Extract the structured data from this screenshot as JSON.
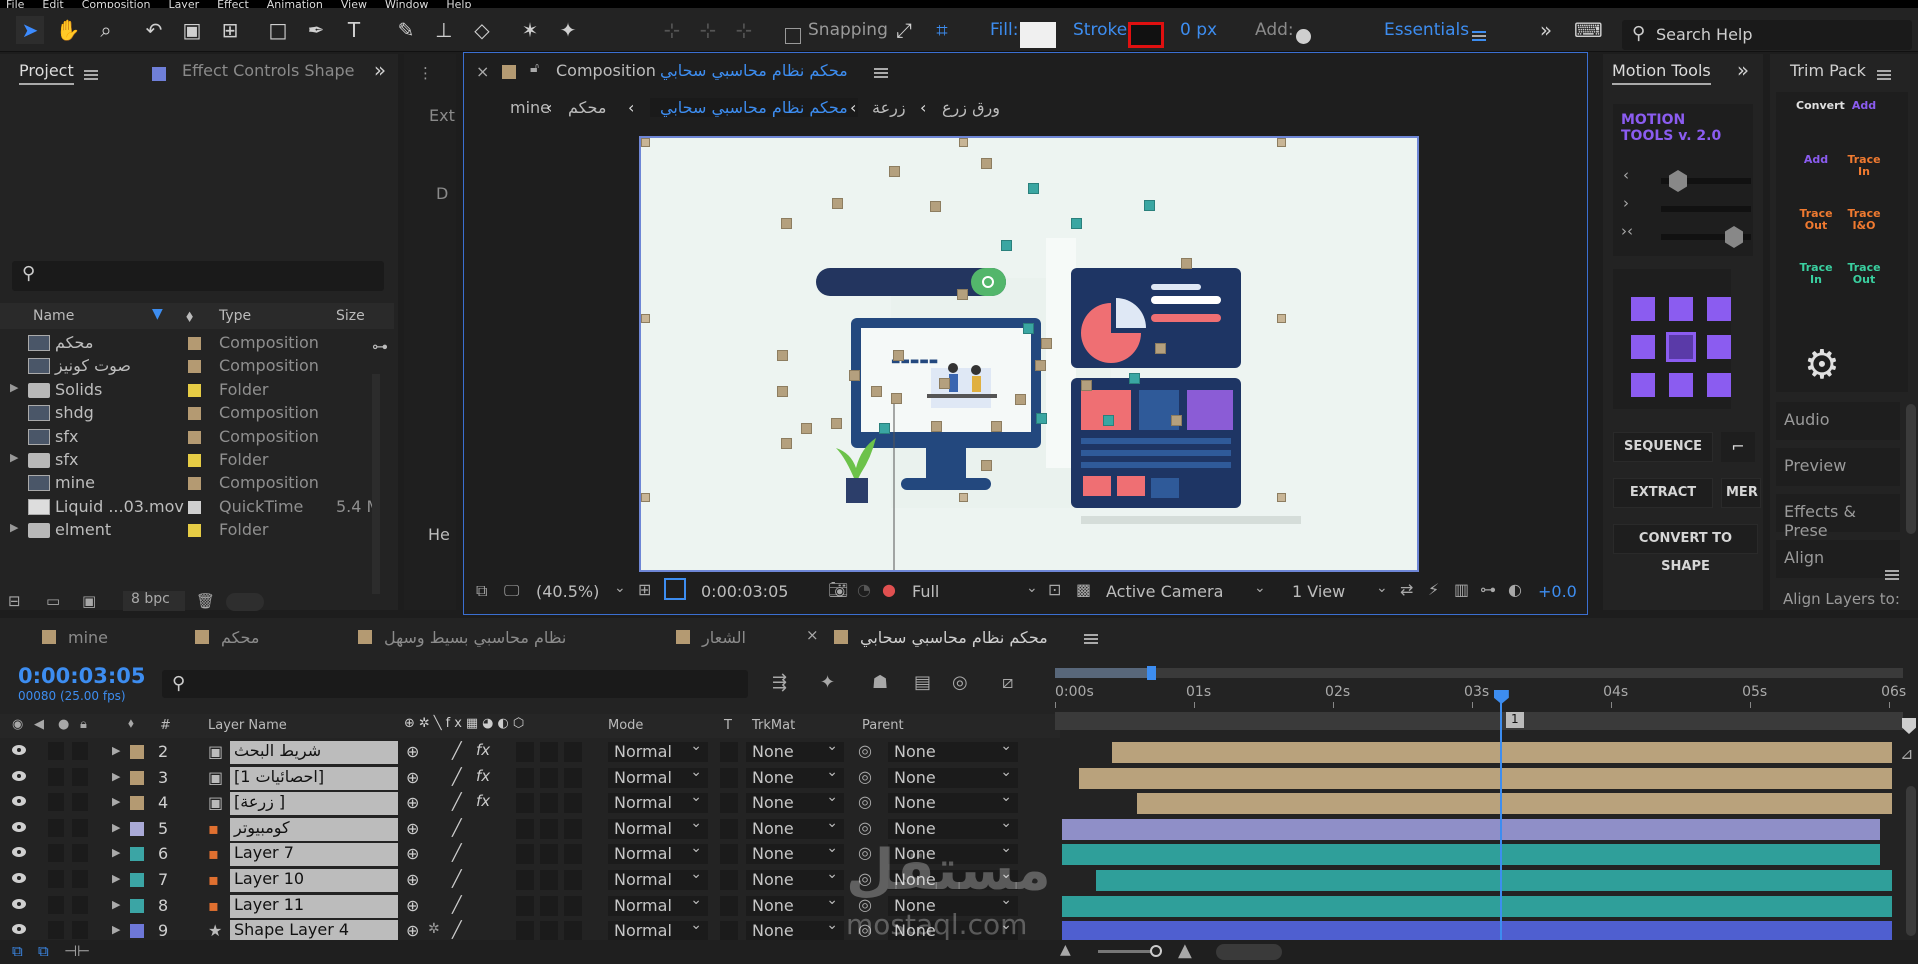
{
  "menubar": [
    "File",
    "Edit",
    "Composition",
    "Layer",
    "Effect",
    "Animation",
    "View",
    "Window",
    "Help"
  ],
  "toolbar": {
    "snapping_label": "Snapping",
    "fill_label": "Fill:",
    "stroke_label": "Stroke:",
    "stroke_px": "0 px",
    "add_label": "Add:",
    "workspace": "Essentials",
    "search_placeholder": "Search Help",
    "colors": {
      "accent": "#3d8df0",
      "stroke_color": "#e01010",
      "fill_color": "#f0f0f0"
    }
  },
  "project_panel": {
    "tab_project": "Project",
    "tab_effect_controls": "Effect Controls Shape",
    "columns": {
      "name": "Name",
      "type": "Type",
      "size": "Size"
    },
    "items": [
      {
        "name": "محكم",
        "type": "Composition",
        "size": "",
        "kind": "comp",
        "color": "#b49a72"
      },
      {
        "name": "صوت كونيز",
        "type": "Composition",
        "size": "",
        "kind": "comp",
        "color": "#b49a72"
      },
      {
        "name": "Solids",
        "type": "Folder",
        "size": "",
        "kind": "folder",
        "color": "#e6cc45"
      },
      {
        "name": "shdg",
        "type": "Composition",
        "size": "",
        "kind": "comp",
        "color": "#b49a72"
      },
      {
        "name": "sfx",
        "type": "Composition",
        "size": "",
        "kind": "comp",
        "color": "#b49a72"
      },
      {
        "name": "sfx",
        "type": "Folder",
        "size": "",
        "kind": "folder",
        "color": "#e6cc45"
      },
      {
        "name": "mine",
        "type": "Composition",
        "size": "",
        "kind": "comp",
        "color": "#b49a72"
      },
      {
        "name": "Liquid ...03.mov",
        "type": "QuickTime",
        "size": "5.4 M",
        "kind": "movie",
        "color": "#cfcfcf"
      },
      {
        "name": "elment",
        "type": "Folder",
        "size": "",
        "kind": "folder",
        "color": "#e6cc45"
      }
    ],
    "bpc": "8 bpc"
  },
  "side_strip": {
    "a": "Ext",
    "b": "D",
    "c": "He"
  },
  "comp_viewer": {
    "tab_label": "Composition",
    "tab_comp_name": "محكم نظام محاسبي سحابي",
    "breadcrumbs": [
      "mine",
      "محكم",
      "محكم نظام محاسبي سحابي",
      "زرعة",
      "ورق زرع"
    ],
    "active_crumb": 2,
    "zoom": "(40.5%)",
    "timecode": "0:00:03:05",
    "resolution": "Full",
    "camera": "Active Camera",
    "views": "1 View",
    "exposure": "+0.0"
  },
  "motion_tools": {
    "tab_label": "Motion Tools",
    "logo_line1": "MOTION",
    "logo_line2": "TOOLS v. 2.0",
    "btn_sequence": "SEQUENCE",
    "btn_extract": "EXTRACT",
    "btn_merge": "MER",
    "btn_convert": "CONVERT TO SHAPE"
  },
  "trim_pack": {
    "tab_label": "Trim Pack",
    "buttons": [
      "Convert",
      "Add",
      "Add",
      "Trace In",
      "Trace Out",
      "Trace I&O",
      "Trace In",
      "Trace Out"
    ],
    "panels": [
      "Audio",
      "Preview",
      "Effects & Prese",
      "Align"
    ],
    "align_sub": "Align Layers to:"
  },
  "timeline": {
    "tabs": [
      {
        "label": "mine",
        "color": "#b49a72"
      },
      {
        "label": "محكم",
        "color": "#b49a72"
      },
      {
        "label": "نظام محاسبي بسيط وسهل",
        "color": "#b49a72"
      },
      {
        "label": "الشعار",
        "color": "#b49a72"
      },
      {
        "label": "محكم نظام محاسبي سحابي",
        "color": "#b49a72"
      }
    ],
    "timecode": "0:00:03:05",
    "frames": "00080 (25.00 fps)",
    "columns": {
      "hash": "#",
      "layer_name": "Layer Name",
      "mode": "Mode",
      "t": "T",
      "trkmat": "TrkMat",
      "parent": "Parent"
    },
    "ruler": [
      "0:00s",
      "01s",
      "02s",
      "03s",
      "04s",
      "05s",
      "06s"
    ],
    "marker": "1",
    "layers": [
      {
        "num": "2",
        "name": "شريط البحث",
        "mode": "Normal",
        "trkmat": "None",
        "parent": "None",
        "color": "#b49a72",
        "icon": "comp",
        "fx": true,
        "bar_start": 0.06,
        "bar_color": "#b9a27c"
      },
      {
        "num": "3",
        "name": "[احصائيات 1]",
        "mode": "Normal",
        "trkmat": "None",
        "parent": "None",
        "color": "#b49a72",
        "icon": "comp",
        "fx": true,
        "bar_start": 0.02,
        "bar_color": "#b9a27c"
      },
      {
        "num": "4",
        "name": "[زرعة ]",
        "mode": "Normal",
        "trkmat": "None",
        "parent": "None",
        "color": "#b49a72",
        "icon": "comp",
        "fx": true,
        "bar_start": 0.09,
        "bar_color": "#b9a27c"
      },
      {
        "num": "5",
        "name": "كومبيوتر",
        "mode": "Normal",
        "trkmat": "None",
        "parent": "None",
        "color": "#a9a9d6",
        "icon": "ai",
        "fx": false,
        "bar_start": 0.0,
        "bar_color": "#8f8fc8"
      },
      {
        "num": "6",
        "name": "Layer 7",
        "mode": "Normal",
        "trkmat": "None",
        "parent": "None",
        "color": "#3ba5a5",
        "icon": "ai",
        "fx": false,
        "bar_start": 0.0,
        "bar_color": "#2f9f9a"
      },
      {
        "num": "7",
        "name": "Layer 10",
        "mode": "Normal",
        "trkmat": "None",
        "parent": "None",
        "color": "#3ba5a5",
        "icon": "ai",
        "fx": false,
        "bar_start": 0.04,
        "bar_color": "#2f9f9a"
      },
      {
        "num": "8",
        "name": "Layer 11",
        "mode": "Normal",
        "trkmat": "None",
        "parent": "None",
        "color": "#3ba5a5",
        "icon": "ai",
        "fx": false,
        "bar_start": 0.0,
        "bar_color": "#2f9f9a"
      },
      {
        "num": "9",
        "name": "Shape Layer 4",
        "mode": "Normal",
        "trkmat": "None",
        "parent": "None",
        "color": "#6e78d8",
        "icon": "shape",
        "fx": false,
        "bar_start": 0.0,
        "bar_color": "#4f5fd0"
      }
    ],
    "playhead_seconds": 3.2,
    "duration_seconds": 6.1
  },
  "watermark": {
    "arabic": "مستقل",
    "latin": "mostaql.com"
  }
}
